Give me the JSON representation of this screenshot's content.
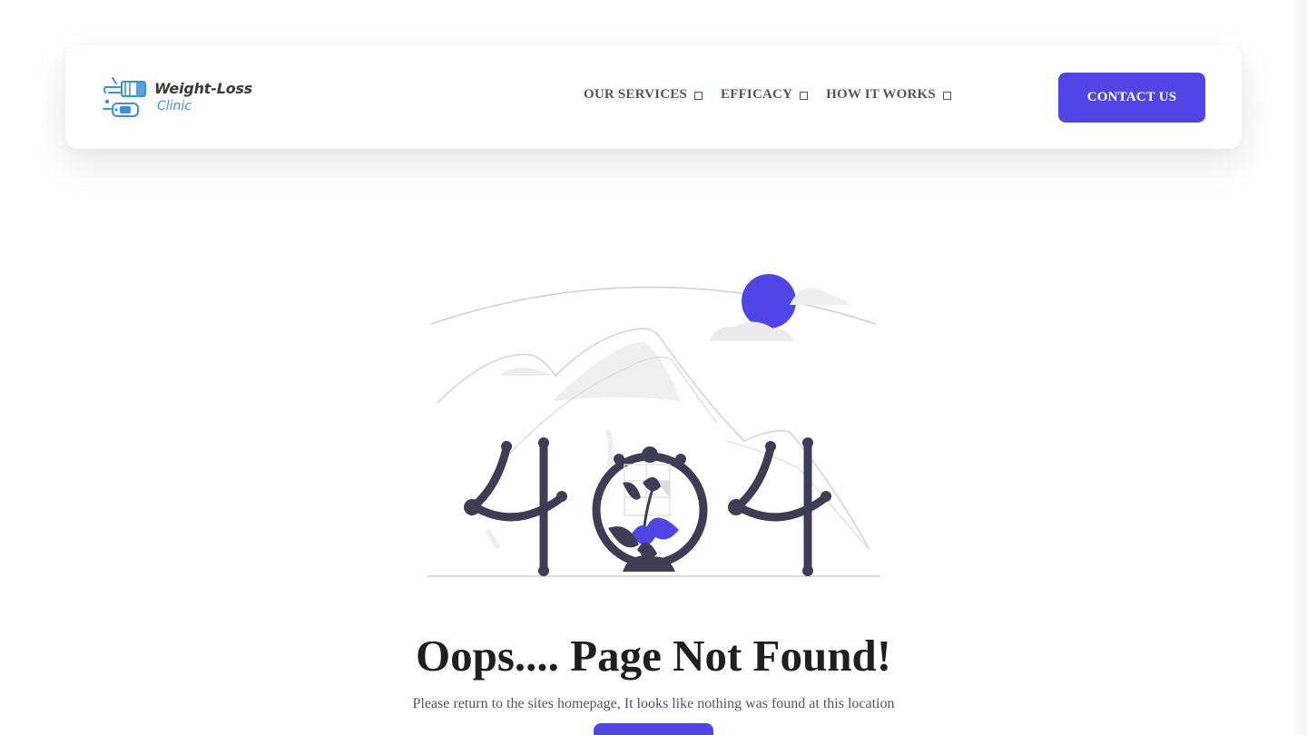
{
  "brand": {
    "name_line1": "Weight-Loss",
    "name_line2": "Clinic"
  },
  "nav": {
    "items": [
      {
        "label": "OUR SERVICES",
        "icon": "dropdown-indicator"
      },
      {
        "label": "EFFICACY",
        "icon": "dropdown-indicator"
      },
      {
        "label": "HOW IT WORKS",
        "icon": "dropdown-indicator"
      }
    ],
    "contact_label": "CONTACT US"
  },
  "error": {
    "code_illustration": "404",
    "title": "Oops.... Page Not Found!",
    "message": "Please return to the sites homepage, It looks like nothing was found at this location"
  },
  "colors": {
    "accent": "#4f46e5",
    "text_dark": "#1f1f1f",
    "nav_text": "#4a5565",
    "illustration_dark": "#3f3d56",
    "logo_blue": "#3d8fd8"
  }
}
